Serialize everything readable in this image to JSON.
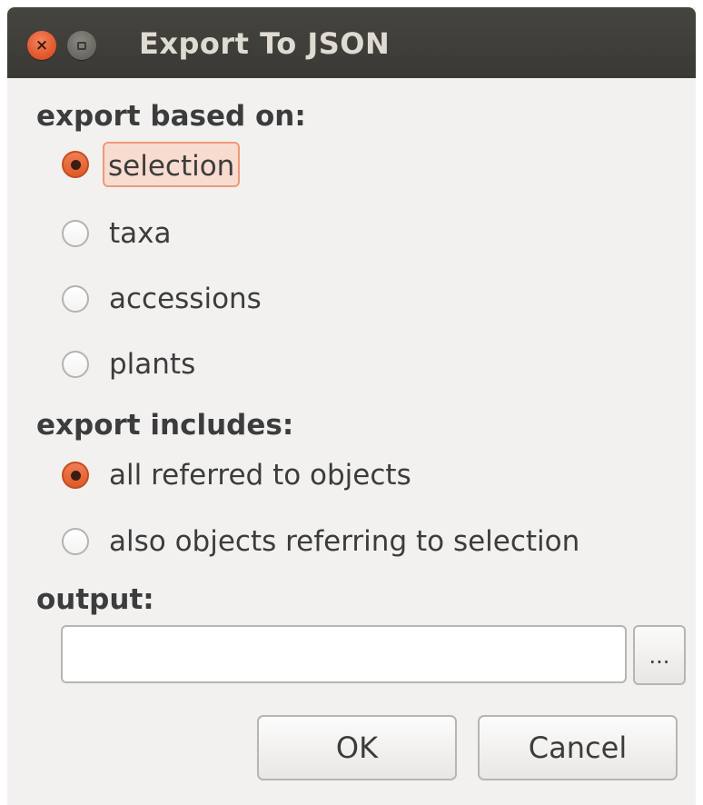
{
  "window": {
    "title": "Export To JSON",
    "close_glyph": "×",
    "close_icon": "close-icon",
    "maximize_icon": "maximize-icon"
  },
  "export_based_on": {
    "label": "export based on:",
    "options": [
      {
        "label": "selection",
        "selected": true
      },
      {
        "label": "taxa",
        "selected": false
      },
      {
        "label": "accessions",
        "selected": false
      },
      {
        "label": "plants",
        "selected": false
      }
    ]
  },
  "export_includes": {
    "label": "export includes:",
    "options": [
      {
        "label": "all referred to objects",
        "selected": true
      },
      {
        "label": "also objects referring to selection",
        "selected": false
      }
    ]
  },
  "output": {
    "label": "output:",
    "value": "",
    "placeholder": "",
    "browse_label": "..."
  },
  "buttons": {
    "ok_label": "OK",
    "cancel_label": "Cancel"
  },
  "colors": {
    "accent": "#e25a2c",
    "titlebar": "#3c3b37",
    "background": "#f2f1f0"
  }
}
